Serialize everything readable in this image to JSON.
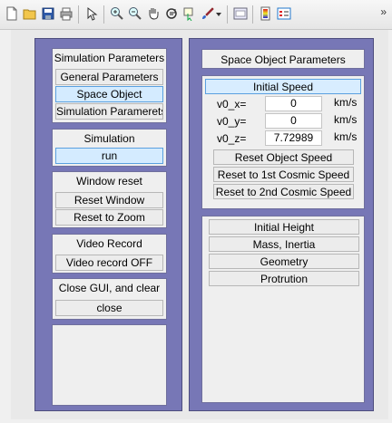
{
  "toolbar": {
    "icons": [
      "new-file-icon",
      "open-folder-icon",
      "save-icon",
      "print-icon",
      "pointer-icon",
      "zoom-in-icon",
      "zoom-out-icon",
      "pan-hand-icon",
      "rotate-3d-icon",
      "data-cursor-icon",
      "brush-icon",
      "dropdown-arrow-icon",
      "link-plot-icon",
      "colorbar-icon",
      "legend-icon"
    ],
    "more": "»"
  },
  "left": {
    "sim_params": {
      "title": "Simulation Parameters",
      "buttons": [
        "General Parameters",
        "Space Object",
        "Simulation Paramerets"
      ]
    },
    "simulation": {
      "title": "Simulation",
      "run": "run"
    },
    "window_reset": {
      "title": "Window reset",
      "reset_window": "Reset Window",
      "reset_zoom": "Reset to Zoom"
    },
    "video": {
      "title": "Video Record",
      "button": "Video record OFF"
    },
    "close": {
      "title": "Close GUI, and clear",
      "button": "close"
    }
  },
  "right": {
    "title": "Space Object Parameters",
    "initial_speed": "Initial Speed",
    "rows": [
      {
        "label": "v0_x=",
        "value": "0",
        "unit": "km/s"
      },
      {
        "label": "v0_y=",
        "value": "0",
        "unit": "km/s"
      },
      {
        "label": "v0_z=",
        "value": "7.72989",
        "unit": "km/s"
      }
    ],
    "reset_object_speed": "Reset Object Speed",
    "reset_first": "Reset to 1st Cosmic Speed",
    "reset_second": "Reset to 2nd Cosmic Speed",
    "sections": [
      "Initial Height",
      "Mass, Inertia",
      "Geometry",
      "Protrution"
    ]
  },
  "colors": {
    "panel": "#7777b6",
    "active": "#d4ebff",
    "active_border": "#5aa0df"
  }
}
